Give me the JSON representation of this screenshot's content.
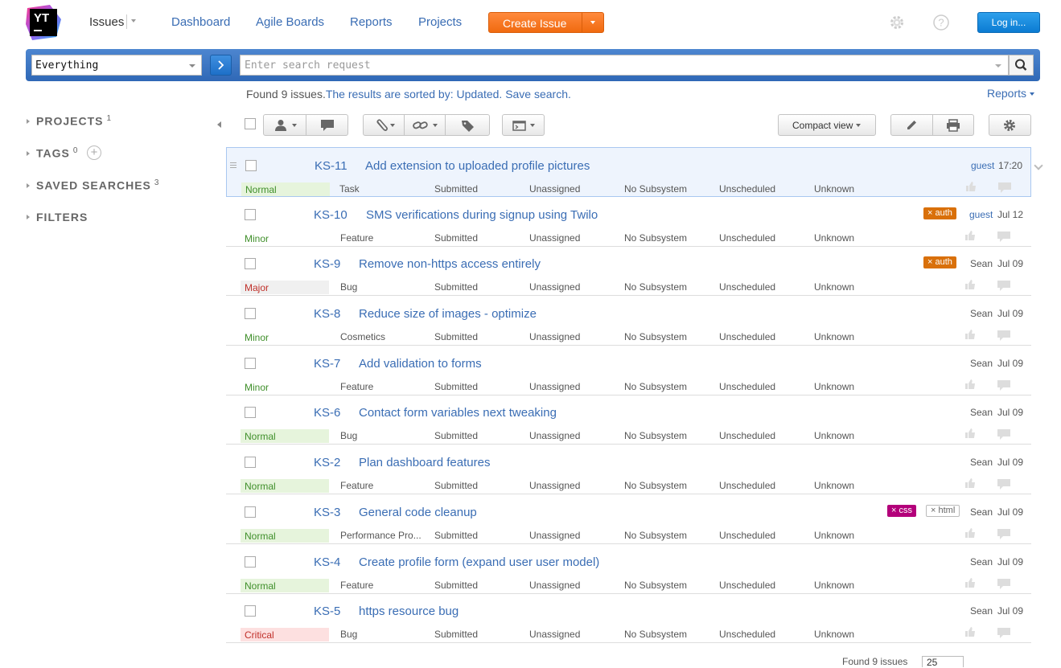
{
  "header": {
    "logo_text": "YT",
    "issues_label": "Issues",
    "nav": [
      "Dashboard",
      "Agile Boards",
      "Reports",
      "Projects"
    ],
    "create_issue_label": "Create Issue",
    "login_label": "Log in..."
  },
  "search": {
    "context_value": "Everything",
    "placeholder": "Enter search request"
  },
  "sidebar": {
    "items": [
      {
        "label": "PROJECTS",
        "count": "1"
      },
      {
        "label": "TAGS",
        "count": "0"
      },
      {
        "label": "SAVED SEARCHES",
        "count": "3"
      },
      {
        "label": "FILTERS",
        "count": ""
      }
    ]
  },
  "results": {
    "found_text": "Found 9 issues.",
    "sorted_text": "The results are sorted by: Updated.",
    "save_search": "Save search.",
    "reports_label": "Reports"
  },
  "toolbar": {
    "compact_view_label": "Compact view"
  },
  "issues": [
    {
      "id": "KS-11",
      "summary": "Add extension to uploaded profile pictures",
      "priority": "Normal",
      "type": "Task",
      "state": "Submitted",
      "assignee": "Unassigned",
      "subsystem": "No Subsystem",
      "fix_version": "Unscheduled",
      "fixed_in": "Unknown",
      "tags": [],
      "reporter": "guest",
      "updated": "17:20"
    },
    {
      "id": "KS-10",
      "summary": "SMS verifications during signup using Twilo",
      "priority": "Minor",
      "type": "Feature",
      "state": "Submitted",
      "assignee": "Unassigned",
      "subsystem": "No Subsystem",
      "fix_version": "Unscheduled",
      "fixed_in": "Unknown",
      "tags": [
        "× auth"
      ],
      "reporter": "guest",
      "updated": "Jul 12"
    },
    {
      "id": "KS-9",
      "summary": "Remove non-https access entirely",
      "priority": "Major",
      "type": "Bug",
      "state": "Submitted",
      "assignee": "Unassigned",
      "subsystem": "No Subsystem",
      "fix_version": "Unscheduled",
      "fixed_in": "Unknown",
      "tags": [
        "× auth"
      ],
      "reporter": "Sean",
      "updated": "Jul 09"
    },
    {
      "id": "KS-8",
      "summary": "Reduce size of images - optimize",
      "priority": "Minor",
      "type": "Cosmetics",
      "state": "Submitted",
      "assignee": "Unassigned",
      "subsystem": "No Subsystem",
      "fix_version": "Unscheduled",
      "fixed_in": "Unknown",
      "tags": [],
      "reporter": "Sean",
      "updated": "Jul 09"
    },
    {
      "id": "KS-7",
      "summary": "Add validation to forms",
      "priority": "Minor",
      "type": "Feature",
      "state": "Submitted",
      "assignee": "Unassigned",
      "subsystem": "No Subsystem",
      "fix_version": "Unscheduled",
      "fixed_in": "Unknown",
      "tags": [],
      "reporter": "Sean",
      "updated": "Jul 09"
    },
    {
      "id": "KS-6",
      "summary": "Contact form variables next tweaking",
      "priority": "Normal",
      "type": "Bug",
      "state": "Submitted",
      "assignee": "Unassigned",
      "subsystem": "No Subsystem",
      "fix_version": "Unscheduled",
      "fixed_in": "Unknown",
      "tags": [],
      "reporter": "Sean",
      "updated": "Jul 09"
    },
    {
      "id": "KS-2",
      "summary": "Plan dashboard features",
      "priority": "Normal",
      "type": "Feature",
      "state": "Submitted",
      "assignee": "Unassigned",
      "subsystem": "No Subsystem",
      "fix_version": "Unscheduled",
      "fixed_in": "Unknown",
      "tags": [],
      "reporter": "Sean",
      "updated": "Jul 09"
    },
    {
      "id": "KS-3",
      "summary": "General code cleanup",
      "priority": "Normal",
      "type": "Performance Pro...",
      "state": "Submitted",
      "assignee": "Unassigned",
      "subsystem": "No Subsystem",
      "fix_version": "Unscheduled",
      "fixed_in": "Unknown",
      "tags": [
        "× css",
        "× html"
      ],
      "reporter": "Sean",
      "updated": "Jul 09"
    },
    {
      "id": "KS-4",
      "summary": "Create profile form (expand user user model)",
      "priority": "Normal",
      "type": "Feature",
      "state": "Submitted",
      "assignee": "Unassigned",
      "subsystem": "No Subsystem",
      "fix_version": "Unscheduled",
      "fixed_in": "Unknown",
      "tags": [],
      "reporter": "Sean",
      "updated": "Jul 09"
    },
    {
      "id": "KS-5",
      "summary": "https resource bug",
      "priority": "Critical",
      "type": "Bug",
      "state": "Submitted",
      "assignee": "Unassigned",
      "subsystem": "No Subsystem",
      "fix_version": "Unscheduled",
      "fixed_in": "Unknown",
      "tags": [],
      "reporter": "Sean",
      "updated": "Jul 09"
    }
  ],
  "pager": {
    "text": "Found 9 issues",
    "page_size": "25"
  },
  "colors": {
    "link": "#3a6db4",
    "create_button": "#f47a23",
    "login_button": "#1a8be0",
    "priority_normal": "#e6f4dc",
    "priority_major": "#f0f0f0",
    "priority_critical": "#fde0e0"
  }
}
